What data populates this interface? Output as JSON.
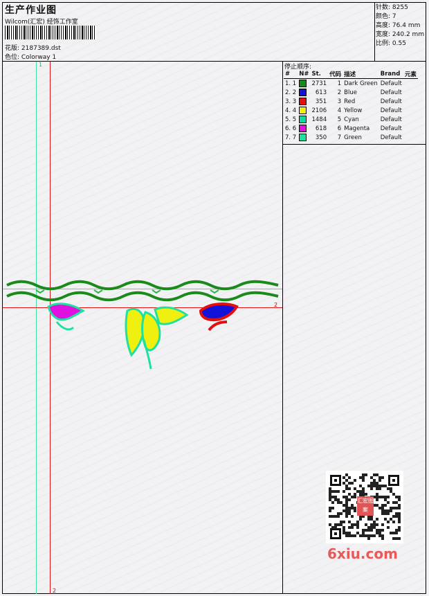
{
  "header": {
    "title": "生产作业图",
    "software": "Wilcom(汇宏) 经饰工作室",
    "design_label": "花版:",
    "design_value": "2187389.dst",
    "colorway_label": "色位:",
    "colorway_value": "Colorway 1"
  },
  "stats": {
    "stitches_label": "针数:",
    "stitches_value": "8255",
    "colors_label": "颜色:",
    "colors_value": "7",
    "height_label": "高度:",
    "height_value": "76.4 mm",
    "width_label": "宽度:",
    "width_value": "240.2 mm",
    "scale_label": "比例:",
    "scale_value": "0.55"
  },
  "guides": {
    "vertical_green_label": "1",
    "horizontal_red_label": "2",
    "vertical_red_label": "2"
  },
  "legend": {
    "heading": "停止顺序:",
    "columns": [
      "#",
      "N#",
      "St.",
      "代码",
      "描述",
      "Brand",
      "元素"
    ],
    "rows": [
      {
        "idx": "1. 1",
        "color": "#1a8a1a",
        "stitches": "2731",
        "code": "1",
        "desc": "Dark Green",
        "brand": "Default"
      },
      {
        "idx": "2. 2",
        "color": "#1212d8",
        "stitches": "613",
        "code": "2",
        "desc": "Blue",
        "brand": "Default"
      },
      {
        "idx": "3. 3",
        "color": "#e01010",
        "stitches": "351",
        "code": "3",
        "desc": "Red",
        "brand": "Default"
      },
      {
        "idx": "4. 4",
        "color": "#f0f010",
        "stitches": "2106",
        "code": "4",
        "desc": "Yellow",
        "brand": "Default"
      },
      {
        "idx": "5. 5",
        "color": "#10d8a0",
        "stitches": "1484",
        "code": "5",
        "desc": "Cyan",
        "brand": "Default"
      },
      {
        "idx": "6. 6",
        "color": "#e010e0",
        "stitches": "618",
        "code": "6",
        "desc": "Magenta",
        "brand": "Default"
      },
      {
        "idx": "7. 7",
        "color": "#20e0a0",
        "stitches": "350",
        "code": "7",
        "desc": "Green",
        "brand": "Default"
      }
    ]
  },
  "watermark": {
    "text": "6xiu.com",
    "seal_text": "汇宏图案"
  },
  "colors": {
    "guide_green": "#40e0a0",
    "guide_red": "#e01010"
  }
}
